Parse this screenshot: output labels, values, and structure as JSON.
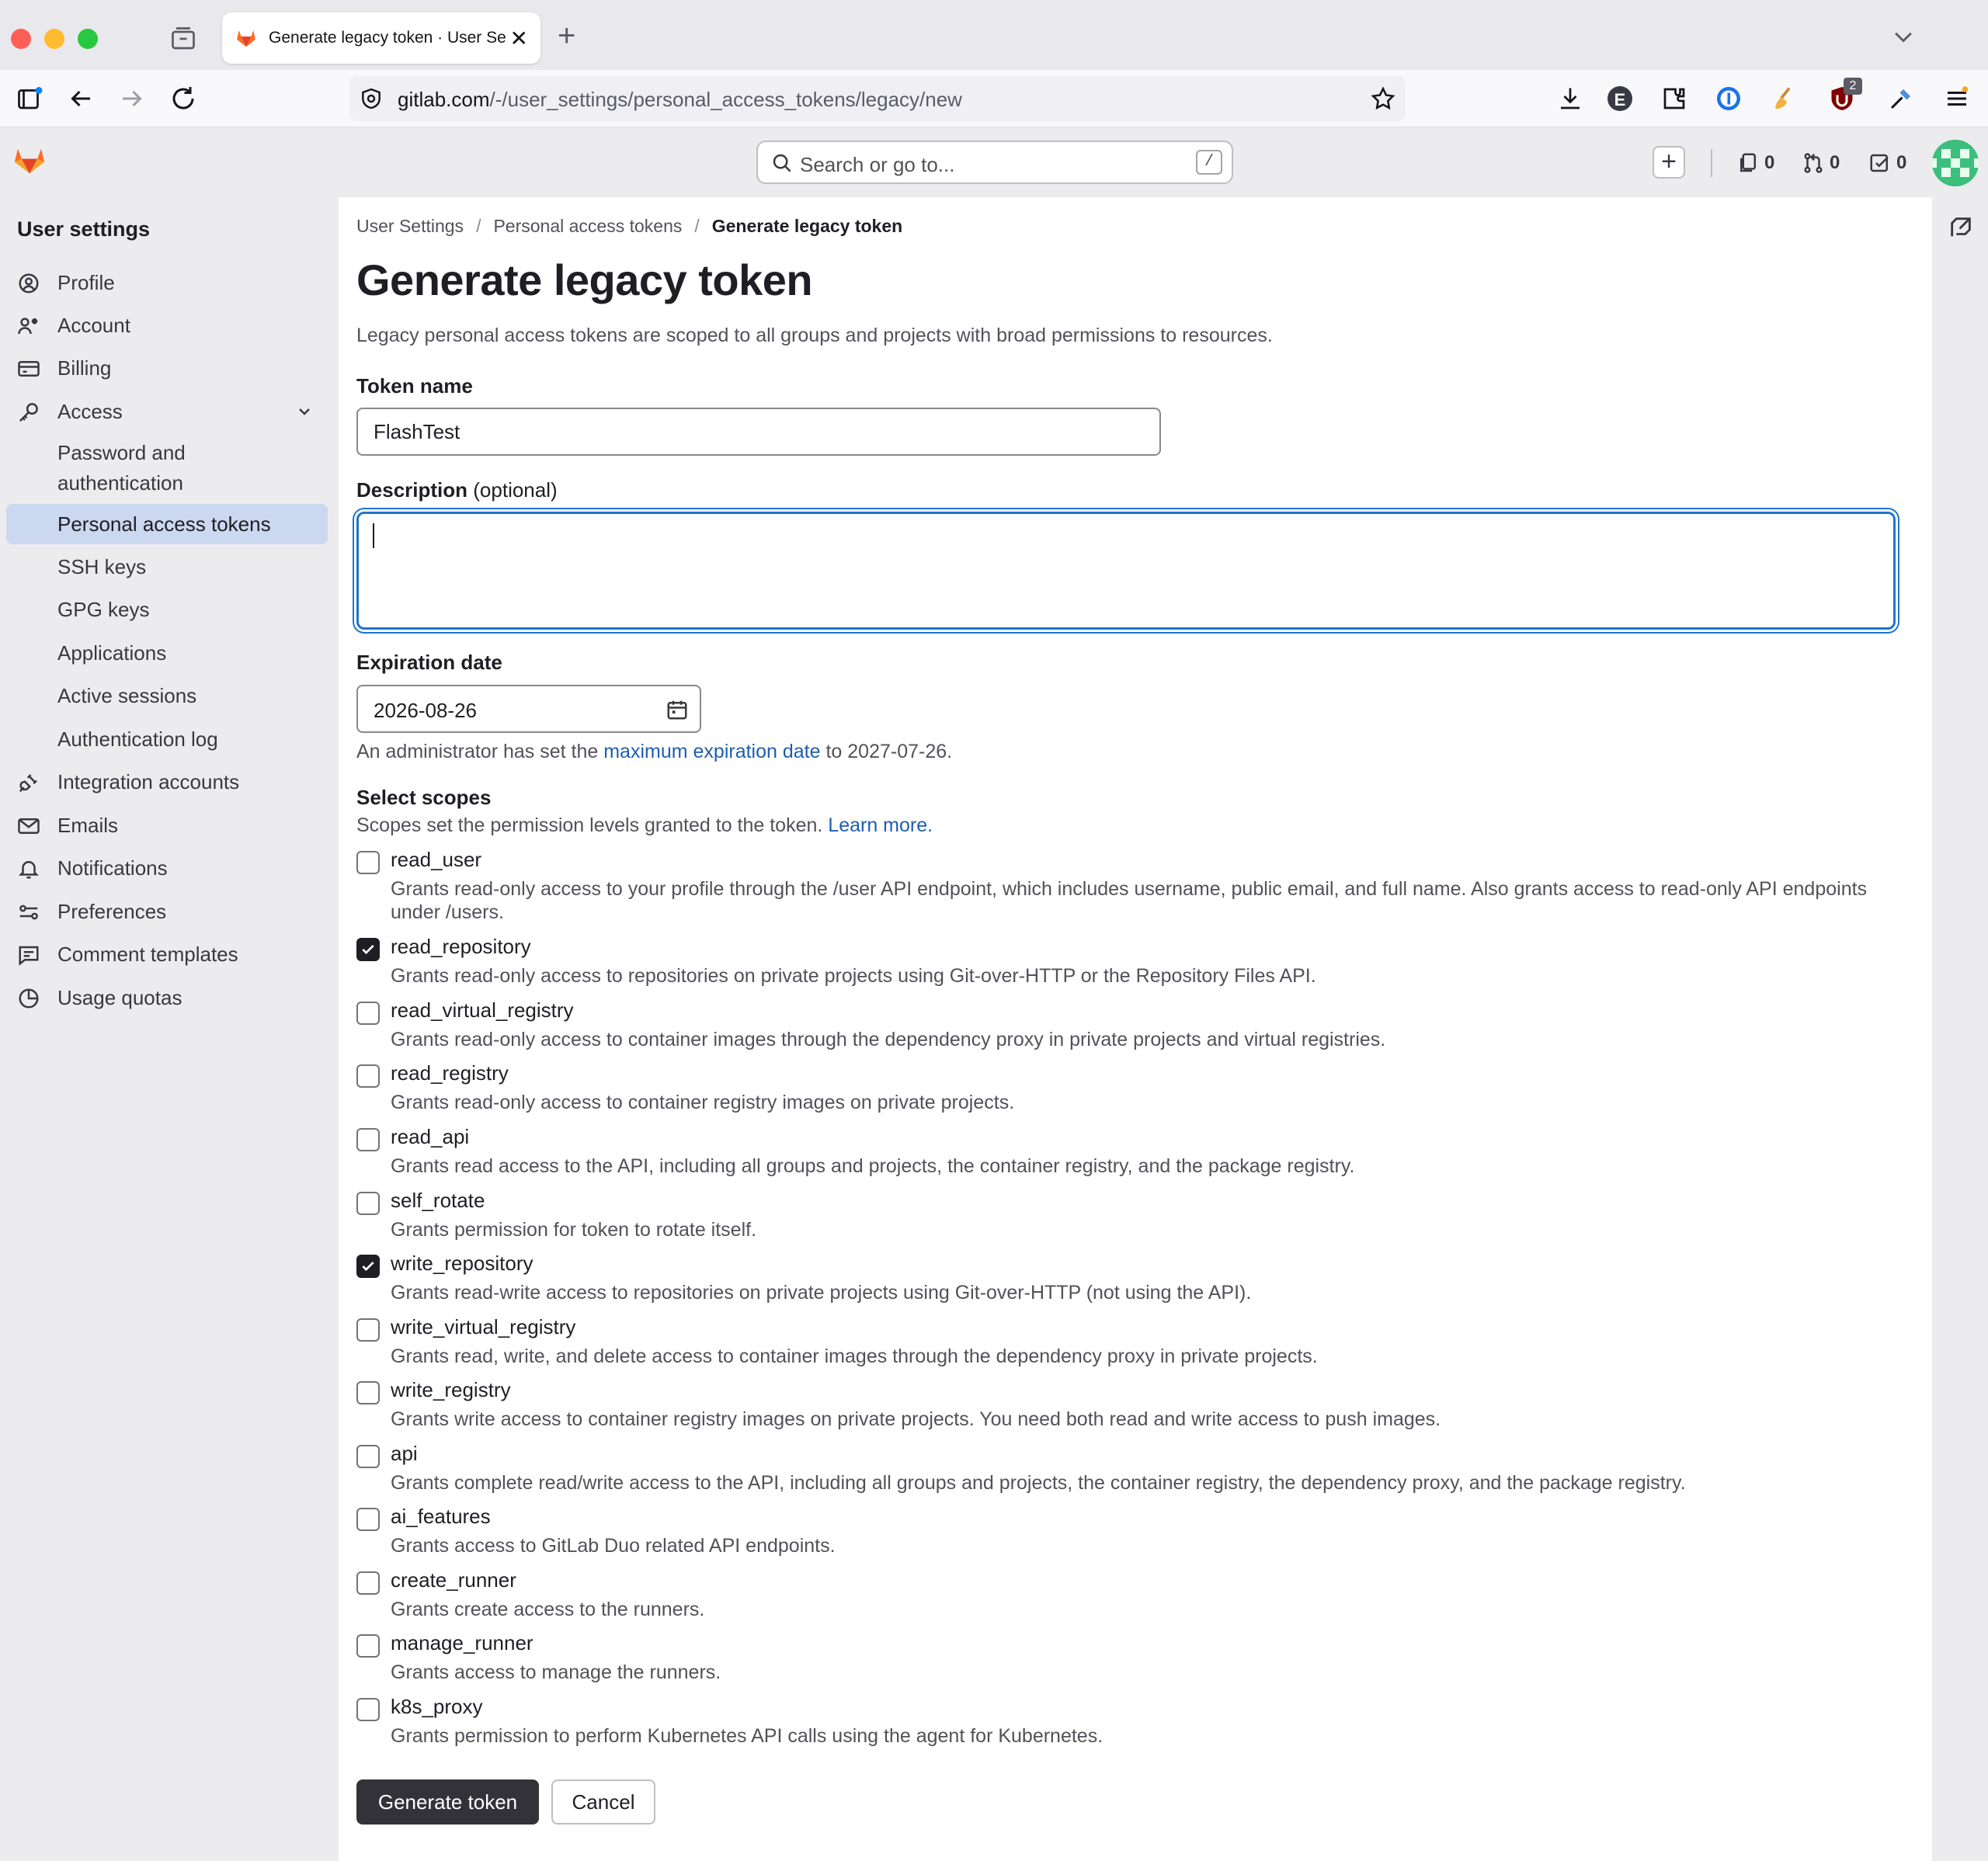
{
  "browser": {
    "tab_title": "Generate legacy token · User Se",
    "url_host": "gitlab.com",
    "url_path": "/-/user_settings/personal_access_tokens/legacy/new",
    "ext_badge": "2",
    "ext_e_label": "E"
  },
  "topbar": {
    "search_placeholder": "Search or go to...",
    "search_shortcut": "/",
    "issues_count": "0",
    "mr_count": "0",
    "todos_count": "0"
  },
  "sidebar": {
    "heading": "User settings",
    "items": [
      {
        "label": "Profile"
      },
      {
        "label": "Account"
      },
      {
        "label": "Billing"
      },
      {
        "label": "Access"
      },
      {
        "label": "Password and authentication"
      },
      {
        "label": "Personal access tokens"
      },
      {
        "label": "SSH keys"
      },
      {
        "label": "GPG keys"
      },
      {
        "label": "Applications"
      },
      {
        "label": "Active sessions"
      },
      {
        "label": "Authentication log"
      },
      {
        "label": "Integration accounts"
      },
      {
        "label": "Emails"
      },
      {
        "label": "Notifications"
      },
      {
        "label": "Preferences"
      },
      {
        "label": "Comment templates"
      },
      {
        "label": "Usage quotas"
      }
    ]
  },
  "breadcrumb": {
    "items": [
      "User Settings",
      "Personal access tokens",
      "Generate legacy token"
    ],
    "separator": "/"
  },
  "page": {
    "title": "Generate legacy token",
    "description": "Legacy personal access tokens are scoped to all groups and projects with broad permissions to resources."
  },
  "form": {
    "token_name_label": "Token name",
    "token_name_value": "FlashTest",
    "description_label": "Description",
    "description_optional": "(optional)",
    "description_value": "",
    "expiration_label": "Expiration date",
    "expiration_value": "2026-08-26",
    "expiration_help_prefix": "An administrator has set the",
    "expiration_help_link": "maximum expiration date",
    "expiration_help_suffix": "to 2027-07-26.",
    "scopes_label": "Select scopes",
    "scopes_help": "Scopes set the permission levels granted to the token.",
    "scopes_learn_more": "Learn more.",
    "scopes": [
      {
        "name": "read_user",
        "checked": false,
        "desc": "Grants read-only access to your profile through the /user API endpoint, which includes username, public email, and full name. Also grants access to read-only API endpoints under /users."
      },
      {
        "name": "read_repository",
        "checked": true,
        "desc": "Grants read-only access to repositories on private projects using Git-over-HTTP or the Repository Files API."
      },
      {
        "name": "read_virtual_registry",
        "checked": false,
        "desc": "Grants read-only access to container images through the dependency proxy in private projects and virtual registries."
      },
      {
        "name": "read_registry",
        "checked": false,
        "desc": "Grants read-only access to container registry images on private projects."
      },
      {
        "name": "read_api",
        "checked": false,
        "desc": "Grants read access to the API, including all groups and projects, the container registry, and the package registry."
      },
      {
        "name": "self_rotate",
        "checked": false,
        "desc": "Grants permission for token to rotate itself."
      },
      {
        "name": "write_repository",
        "checked": true,
        "desc": "Grants read-write access to repositories on private projects using Git-over-HTTP (not using the API)."
      },
      {
        "name": "write_virtual_registry",
        "checked": false,
        "desc": "Grants read, write, and delete access to container images through the dependency proxy in private projects."
      },
      {
        "name": "write_registry",
        "checked": false,
        "desc": "Grants write access to container registry images on private projects. You need both read and write access to push images."
      },
      {
        "name": "api",
        "checked": false,
        "desc": "Grants complete read/write access to the API, including all groups and projects, the container registry, the dependency proxy, and the package registry."
      },
      {
        "name": "ai_features",
        "checked": false,
        "desc": "Grants access to GitLab Duo related API endpoints."
      },
      {
        "name": "create_runner",
        "checked": false,
        "desc": "Grants create access to the runners."
      },
      {
        "name": "manage_runner",
        "checked": false,
        "desc": "Grants access to manage the runners."
      },
      {
        "name": "k8s_proxy",
        "checked": false,
        "desc": "Grants permission to perform Kubernetes API calls using the agent for Kubernetes."
      }
    ],
    "generate_label": "Generate token",
    "cancel_label": "Cancel"
  },
  "colors": {
    "accent": "#1f75cb",
    "link": "#1f5eb0",
    "sidebar_active": "#cbd8ef",
    "primary_button": "#333238"
  }
}
